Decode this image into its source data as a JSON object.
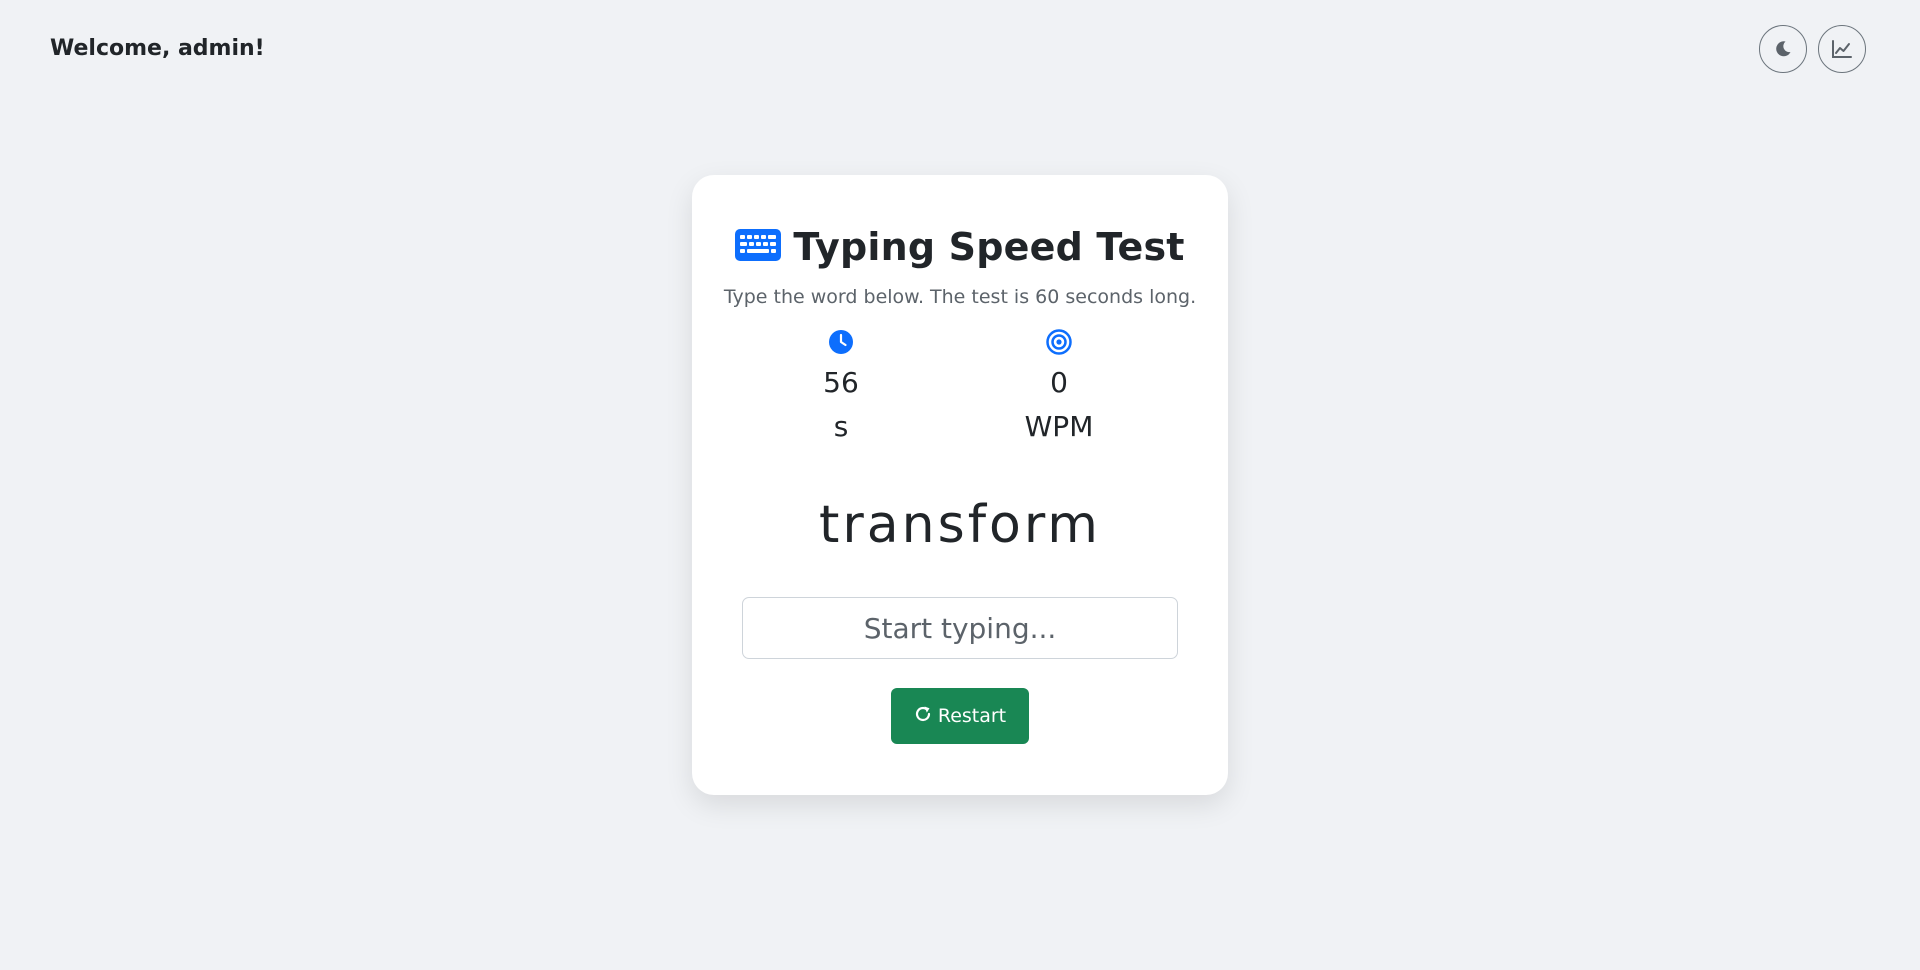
{
  "header": {
    "welcome_text": "Welcome, admin!",
    "theme_toggle_icon": "moon-icon",
    "stats_button_icon": "chart-line-icon"
  },
  "card": {
    "title_icon": "keyboard-icon",
    "title": "Typing Speed Test",
    "subtitle": "Type the word below. The test is 60 seconds long.",
    "timer": {
      "icon": "clock-icon",
      "value": "56",
      "unit": "s"
    },
    "wpm": {
      "icon": "target-icon",
      "value": "0",
      "unit": "WPM"
    },
    "current_word": "transform",
    "input": {
      "value": "",
      "placeholder": "Start typing..."
    },
    "restart": {
      "icon": "rotate-right-icon",
      "label": "Restart"
    }
  },
  "colors": {
    "background": "#f0f2f5",
    "accent_blue": "#0d6efd",
    "restart_green": "#198754",
    "text_dark": "#212529",
    "text_muted": "#5c636a"
  }
}
